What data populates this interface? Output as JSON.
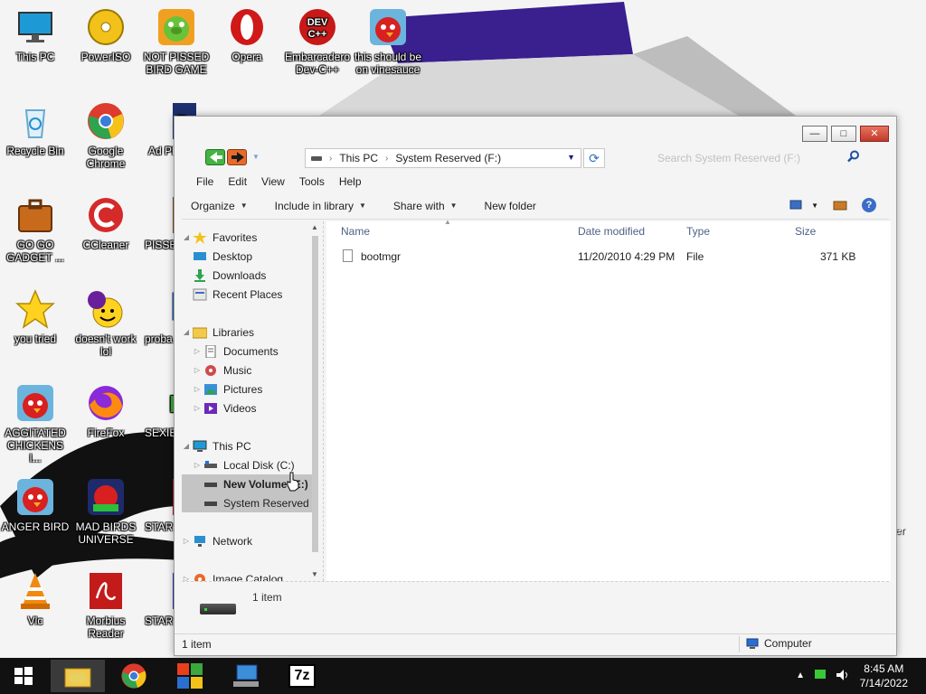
{
  "desktop": {
    "icons": [
      {
        "label": "This PC"
      },
      {
        "label": "PowerISO"
      },
      {
        "label": "NOT PISSED BIRD GAME"
      },
      {
        "label": "Opera"
      },
      {
        "label": "Embarcadero Dev-C++"
      },
      {
        "label": "this should be on vinesauce"
      },
      {
        "label": "Recycle Bin"
      },
      {
        "label": "Google Chrome"
      },
      {
        "label": "Ad Photo"
      },
      {
        "label": "GO GO GADGET ..."
      },
      {
        "label": "CCleaner"
      },
      {
        "label": "PISSE AVIAN"
      },
      {
        "label": "you tried"
      },
      {
        "label": "doesn't work lol"
      },
      {
        "label": "proba a r"
      },
      {
        "label": "AGGITATED CHICKENS I..."
      },
      {
        "label": "FireFox"
      },
      {
        "label": "SEXIE"
      },
      {
        "label": "ANGER BIRD"
      },
      {
        "label": "MAD BIRDS UNIVERSE"
      },
      {
        "label": "STAR"
      },
      {
        "label": "Vlc"
      },
      {
        "label": "Morbius Reader"
      },
      {
        "label": "STAR GA"
      }
    ],
    "edge_text": "er"
  },
  "window": {
    "controls": {
      "minimize": "—",
      "maximize": "□",
      "close": "✕"
    },
    "address": {
      "crumbs": [
        "This PC",
        "System Reserved (F:)"
      ]
    },
    "search": {
      "placeholder": "Search System Reserved (F:)"
    },
    "menu": [
      "File",
      "Edit",
      "View",
      "Tools",
      "Help"
    ],
    "commands": {
      "organize": "Organize",
      "include": "Include in library",
      "share": "Share with",
      "new_folder": "New folder"
    },
    "nav": {
      "favorites": "Favorites",
      "desktop": "Desktop",
      "downloads": "Downloads",
      "recent": "Recent Places",
      "libraries": "Libraries",
      "documents": "Documents",
      "music": "Music",
      "pictures": "Pictures",
      "videos": "Videos",
      "this_pc": "This PC",
      "local_disk": "Local Disk (C:)",
      "new_volume": "New Volume (E:)",
      "system_reserved": "System Reserved",
      "network": "Network",
      "image_catalog": "Image Catalog"
    },
    "columns": {
      "name": "Name",
      "date": "Date modified",
      "type": "Type",
      "size": "Size"
    },
    "files": [
      {
        "name": "bootmgr",
        "date": "11/20/2010 4:29 PM",
        "type": "File",
        "size": "371 KB"
      }
    ],
    "details": {
      "count": "1 item"
    },
    "status": {
      "left": "1 item",
      "right": "Computer"
    }
  },
  "taskbar": {
    "clock_time": "8:45 AM",
    "clock_date": "7/14/2022",
    "app_7z": "7z"
  }
}
